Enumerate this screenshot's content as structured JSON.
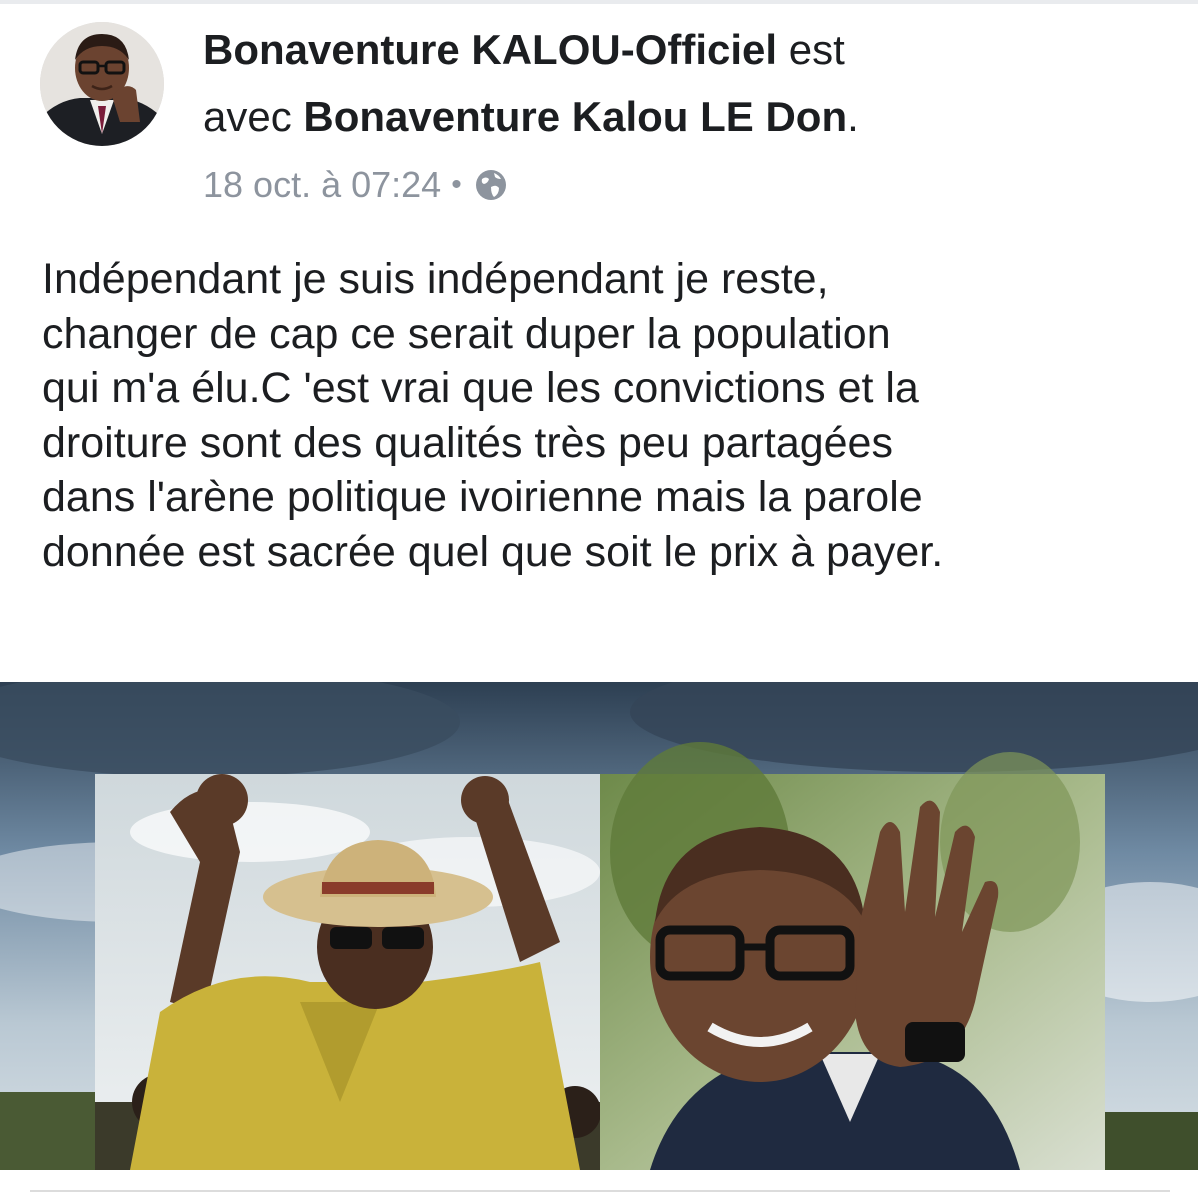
{
  "post": {
    "author": "Bonaventure KALOU-Officiel",
    "with_word": "est",
    "with_prefix": "avec",
    "tagged": "Bonaventure Kalou LE Don",
    "tagged_suffix": ".",
    "timestamp": "18 oct. à 07:24",
    "separator": "•",
    "privacy_icon": "globe-icon",
    "text_lines": [
      "Indépendant je suis indépendant je reste,",
      "changer de cap ce serait duper la population",
      "qui m'a élu.C 'est vrai que les convictions et la",
      "droiture sont des qualités très peu partagées",
      "dans l'arène politique ivoirienne mais la parole",
      "donnée est sacrée quel que soit le prix à payer."
    ]
  },
  "colors": {
    "text": "#1c1e21",
    "meta": "#8d949e",
    "background": "#ffffff"
  }
}
